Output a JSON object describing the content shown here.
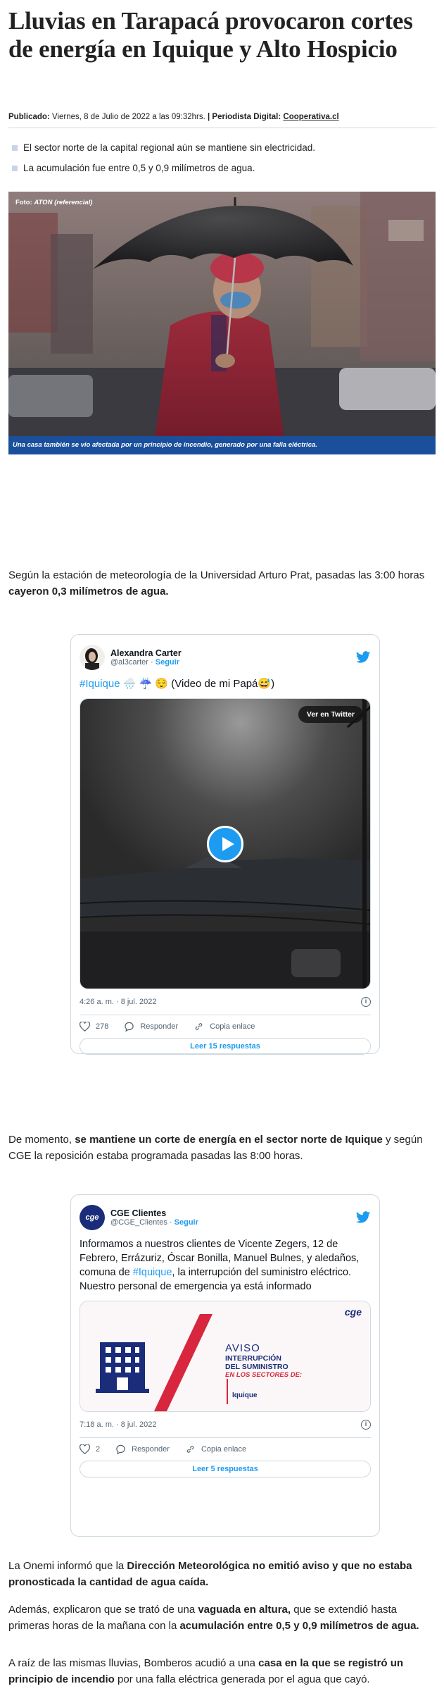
{
  "article": {
    "title": "Lluvias en Tarapacá provocaron cortes de energía en Iquique y Alto Hospicio",
    "meta": {
      "published_label": "Publicado:",
      "date": "Viernes, 8 de Julio de 2022 a las 09:32hrs.",
      "separator": "|",
      "author_label": "Periodista Digital:",
      "author": "Cooperativa.cl"
    },
    "bullets": [
      "El sector norte de la capital regional aún se mantiene sin electricidad.",
      "La acumulación fue entre 0,5 y 0,9 milímetros de agua."
    ],
    "image": {
      "credit_label": "Foto:",
      "credit": "ATON (referencial)",
      "caption": "Una casa también se vio afectada por un principio de incendio, generado por una falla eléctrica."
    },
    "paragraphs": {
      "p1_pre": "Según la estación de meteorología de la Universidad Arturo Prat, pasadas las 3:00 horas ",
      "p1_bold": "cayeron 0,3 milímetros de agua.",
      "p2_pre": "De momento, ",
      "p2_bold": "se mantiene un corte de energía en el sector norte de Iquique",
      "p2_post": " y según CGE la reposición estaba programada pasadas las 8:00 horas.",
      "p3_pre": "La Onemi informó que la ",
      "p3_bold": "Dirección Meteorológica no emitió aviso y que no estaba pronosticada la cantidad de agua caída.",
      "p4_pre": "Además, explicaron que se trató de una ",
      "p4_bold1": "vaguada en altura,",
      "p4_mid": " que se extendió hasta primeras horas de la mañana con la ",
      "p4_bold2": "acumulación entre 0,5 y 0,9 milímetros de agua.",
      "p5_pre": "A raíz de las mismas lluvias, Bomberos acudió a una ",
      "p5_bold": "casa en la que se registró un principio de incendio",
      "p5_post": " por una falla eléctrica generada por el agua que cayó."
    }
  },
  "tweet1": {
    "name": "Alexandra Carter",
    "handle": "@al3carter",
    "dot": " · ",
    "follow": "Seguir",
    "hashtag": "#Iquique",
    "text_rest": " 🌧️ ☔ 😌 (Video de mi Papá😅)",
    "ver_twitter": "Ver en Twitter",
    "timestamp": "4:26 a. m. · 8 jul. 2022",
    "info": "i",
    "likes": "278",
    "reply": "Responder",
    "copy": "Copia enlace",
    "read_replies": "Leer 15 respuestas"
  },
  "tweet2": {
    "name": "CGE Clientes",
    "handle": "@CGE_Clientes",
    "dot": " · ",
    "follow": "Seguir",
    "avatar_text": "cge",
    "text_pre": "Informamos a nuestros clientes de Vicente Zegers, 12 de Febrero, Errázuriz, Óscar Bonilla, Manuel Bulnes, y aledaños, comuna de ",
    "hashtag": "#Iquique",
    "text_post": ", la interrupción del suministro eléctrico. Nuestro personal de emergencia ya está informado",
    "card": {
      "logo": "cge",
      "aviso": "AVISO",
      "line1": "INTERRUPCIÓN",
      "line2": "DEL SUMINISTRO",
      "line3": "EN LOS SECTORES DE:",
      "sector": "Iquique"
    },
    "timestamp": "7:18 a. m. · 8 jul. 2022",
    "info": "i",
    "likes": "2",
    "reply": "Responder",
    "copy": "Copia enlace",
    "read_replies": "Leer 5 respuestas"
  },
  "colors": {
    "caption_bg": "#1a4f9c",
    "twitter_blue": "#1d9bf0",
    "cge_navy": "#1b2d7a",
    "cge_red": "#d7263d",
    "bullet": "#c9d3ea"
  }
}
